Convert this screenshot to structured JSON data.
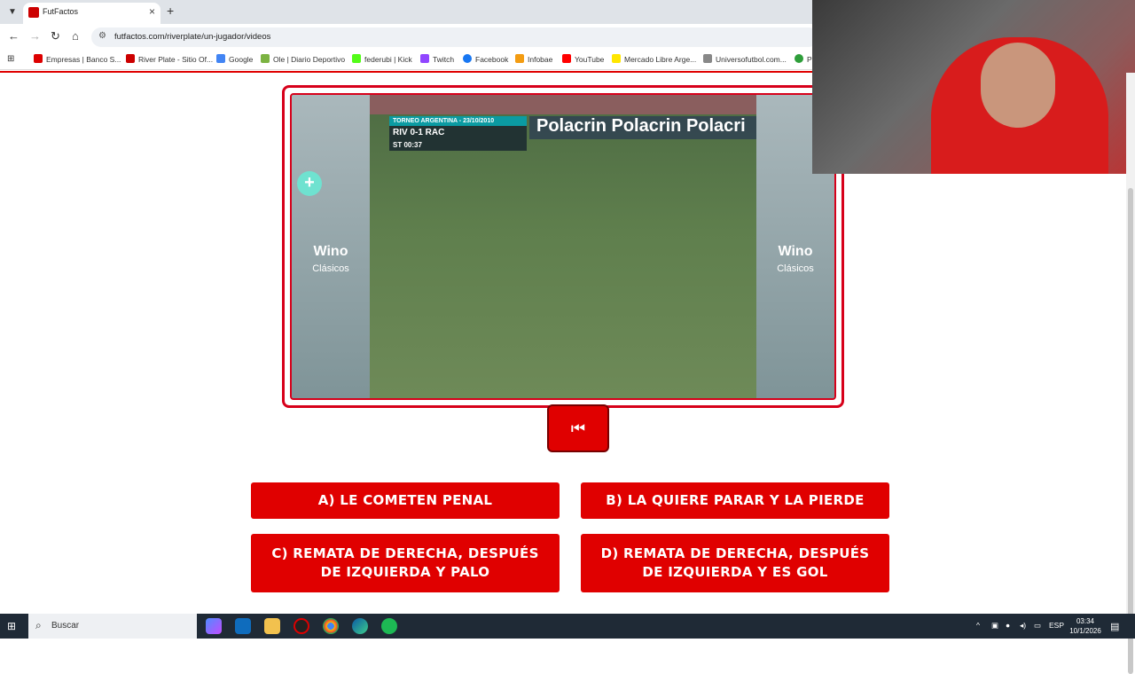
{
  "browser": {
    "tab_title": "FutFactos",
    "tab_close": "×",
    "new_tab": "+",
    "url": "futfactos.com/riverplate/un-jugador/videos",
    "bookmarks": [
      {
        "label": "Empresas | Banco S...",
        "color": "#d00"
      },
      {
        "label": "River Plate - Sitio Of...",
        "color": "#c00"
      },
      {
        "label": "Google",
        "color": "#4285f4"
      },
      {
        "label": "Ole | Diario Deportivo",
        "color": "#7cb342"
      },
      {
        "label": "federubi | Kick",
        "color": "#53fc18"
      },
      {
        "label": "Twitch",
        "color": "#9146ff"
      },
      {
        "label": "Facebook",
        "color": "#1877f2"
      },
      {
        "label": "Infobae",
        "color": "#f39c12"
      },
      {
        "label": "YouTube",
        "color": "#ff0000"
      },
      {
        "label": "Mercado Libre Arge...",
        "color": "#ffe600"
      },
      {
        "label": "Universofutbol.com...",
        "color": "#888"
      },
      {
        "label": "PF",
        "color": "#2e9e3a"
      }
    ]
  },
  "video": {
    "score_header": "TORNEO ARGENTINA - 23/10/2010",
    "score_line": "RIV 0-1 RAC",
    "score_time": "ST 00:37",
    "ad_text": "Polacrin Polacrin Polacri",
    "side_logo": "Wino",
    "side_sub": "Clásicos"
  },
  "controls": {
    "rewind_icon": "⏮"
  },
  "answers": [
    {
      "label": "A) LE COMETEN PENAL"
    },
    {
      "label": "B) LA QUIERE PARAR Y LA PIERDE"
    },
    {
      "label": "C) REMATA DE DERECHA, DESPUÉS DE IZQUIERDA Y PALO"
    },
    {
      "label": "D) REMATA DE DERECHA, DESPUÉS DE IZQUIERDA Y ES GOL"
    }
  ],
  "taskbar": {
    "search_placeholder": "Buscar",
    "lang": "ESP",
    "time": "03:34",
    "date": "10/1/2026"
  },
  "colors": {
    "accent": "#e00000"
  }
}
